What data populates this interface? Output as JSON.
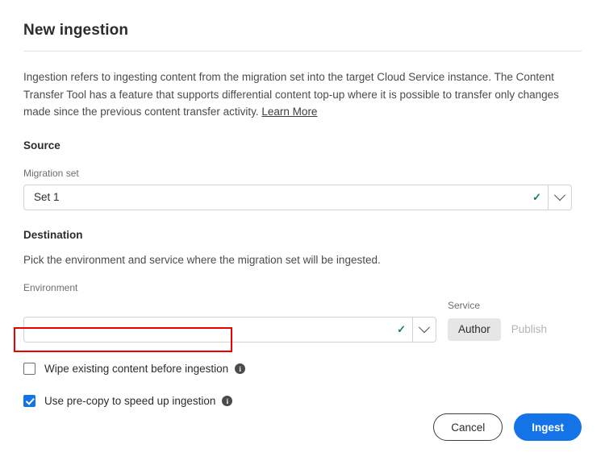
{
  "dialog": {
    "title": "New ingestion",
    "intro": {
      "text": "Ingestion refers to ingesting content from the migration set into the target Cloud Service instance. The Content Transfer Tool has a feature that supports differential content top-up where it is possible to transfer only changes made since the previous content transfer activity. ",
      "link_label": "Learn More"
    }
  },
  "source": {
    "heading": "Source",
    "migration_set": {
      "label": "Migration set",
      "value": "Set 1",
      "placeholder": "",
      "valid_icon": "check-icon",
      "dropdown_icon": "chevron-down-icon"
    }
  },
  "destination": {
    "heading": "Destination",
    "description": "Pick the environment and service where the migration set will be ingested.",
    "environment": {
      "label": "Environment",
      "value": "",
      "placeholder": "",
      "valid_icon": "check-icon",
      "dropdown_icon": "chevron-down-icon"
    },
    "service": {
      "label": "Service",
      "options": [
        {
          "label": "Author",
          "selected": true,
          "disabled": false
        },
        {
          "label": "Publish",
          "selected": false,
          "disabled": true
        }
      ]
    }
  },
  "options": {
    "wipe": {
      "label": "Wipe existing content before ingestion",
      "checked": false,
      "info_icon": "info-icon"
    },
    "precopy": {
      "label": "Use pre-copy to speed up ingestion",
      "checked": true,
      "info_icon": "info-icon"
    }
  },
  "footer": {
    "cancel_label": "Cancel",
    "ingest_label": "Ingest"
  },
  "colors": {
    "accent_blue": "#1473e6",
    "valid_green": "#12805c",
    "highlight_red": "#ee0000",
    "selected_gray": "#e6e6e6",
    "disabled_gray": "#b3b3b3"
  },
  "annotation": {
    "highlight_target": "wipe-existing-content-checkbox-row"
  }
}
